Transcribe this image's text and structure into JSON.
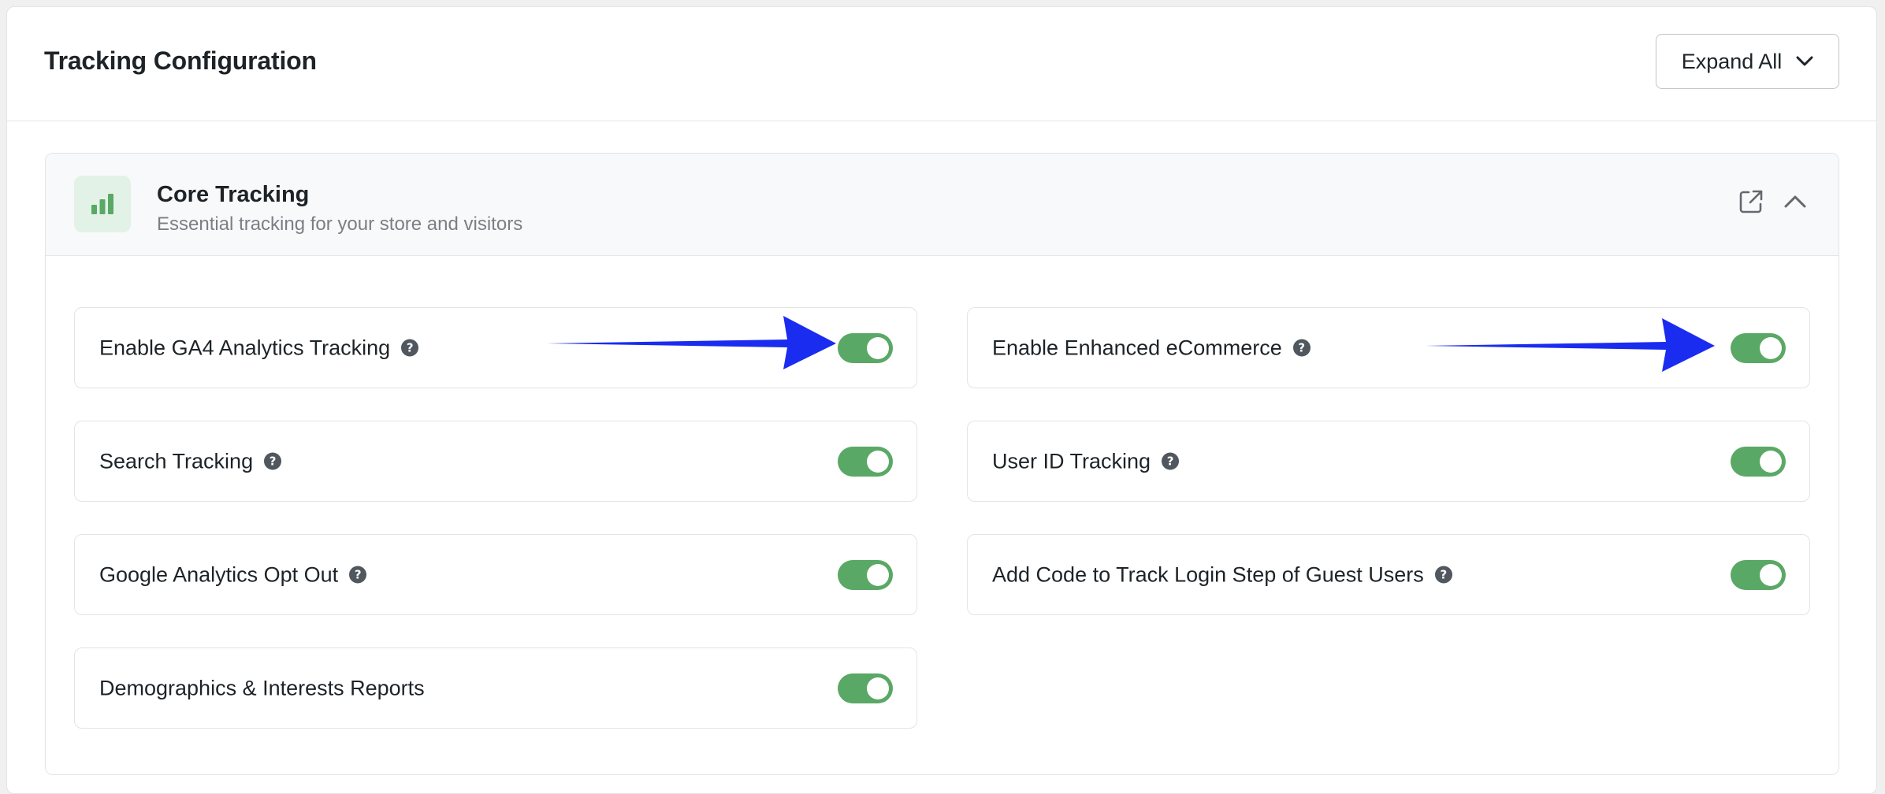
{
  "page": {
    "title": "Tracking Configuration",
    "expand_all_label": "Expand All"
  },
  "section": {
    "title": "Core Tracking",
    "subtitle": "Essential tracking for your store and visitors",
    "icon": "bar-chart-icon",
    "accent_color": "#5aa865"
  },
  "settings": [
    {
      "label": "Enable GA4 Analytics Tracking",
      "enabled": true,
      "help": true
    },
    {
      "label": "Enable Enhanced eCommerce",
      "enabled": true,
      "help": true
    },
    {
      "label": "Search Tracking",
      "enabled": true,
      "help": true
    },
    {
      "label": "User ID Tracking",
      "enabled": true,
      "help": true
    },
    {
      "label": "Google Analytics Opt Out",
      "enabled": true,
      "help": true
    },
    {
      "label": "Add Code to Track Login Step of Guest Users",
      "enabled": true,
      "help": true
    },
    {
      "label": "Demographics & Interests Reports",
      "enabled": true,
      "help": false
    }
  ],
  "help_icon_glyph": "?",
  "annotation_arrow_color": "#1a2cf0"
}
